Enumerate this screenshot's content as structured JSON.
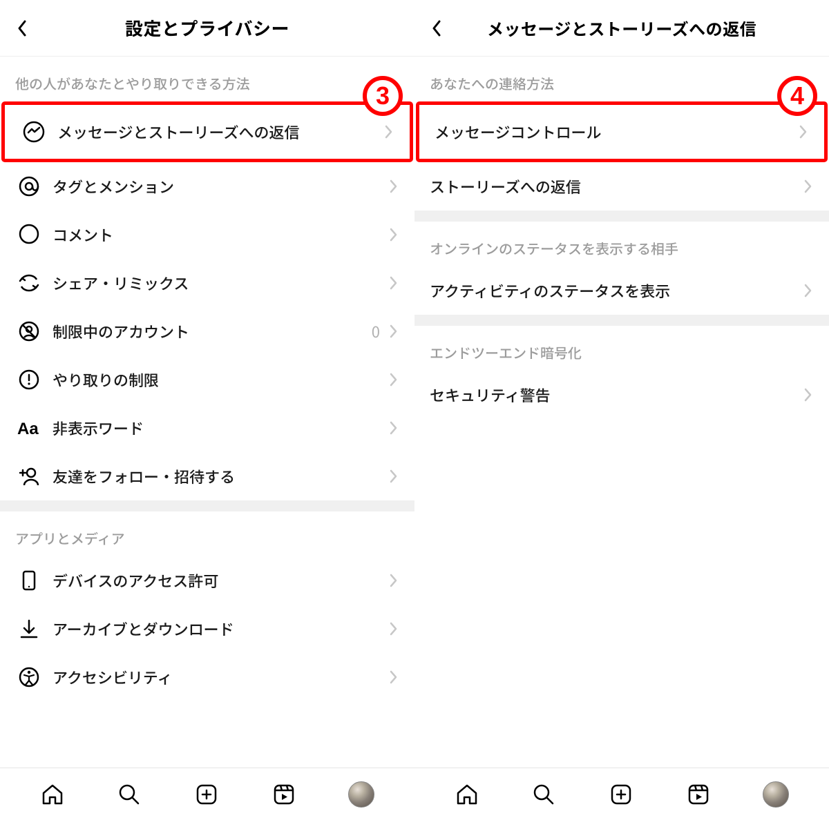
{
  "left": {
    "title": "設定とプライバシー",
    "section1_header": "他の人があなたとやり取りできる方法",
    "items1": [
      {
        "icon": "messenger",
        "label": "メッセージとストーリーズへの返信"
      },
      {
        "icon": "at",
        "label": "タグとメンション"
      },
      {
        "icon": "comment",
        "label": "コメント"
      },
      {
        "icon": "share",
        "label": "シェア・リミックス"
      },
      {
        "icon": "restricted",
        "label": "制限中のアカウント",
        "value": "0"
      },
      {
        "icon": "limit",
        "label": "やり取りの制限"
      },
      {
        "icon": "aa",
        "label": "非表示ワード"
      },
      {
        "icon": "addfriend",
        "label": "友達をフォロー・招待する"
      }
    ],
    "section2_header": "アプリとメディア",
    "items2": [
      {
        "icon": "device",
        "label": "デバイスのアクセス許可"
      },
      {
        "icon": "download",
        "label": "アーカイブとダウンロード"
      },
      {
        "icon": "access",
        "label": "アクセシビリティ"
      }
    ],
    "badge3": "3"
  },
  "right": {
    "title": "メッセージとストーリーズへの返信",
    "section1_header": "あなたへの連絡方法",
    "items1": [
      {
        "label": "メッセージコントロール"
      },
      {
        "label": "ストーリーズへの返信"
      }
    ],
    "section2_header": "オンラインのステータスを表示する相手",
    "items2": [
      {
        "label": "アクティビティのステータスを表示"
      }
    ],
    "section3_header": "エンドツーエンド暗号化",
    "items3": [
      {
        "label": "セキュリティ警告"
      }
    ],
    "badge4": "4"
  }
}
